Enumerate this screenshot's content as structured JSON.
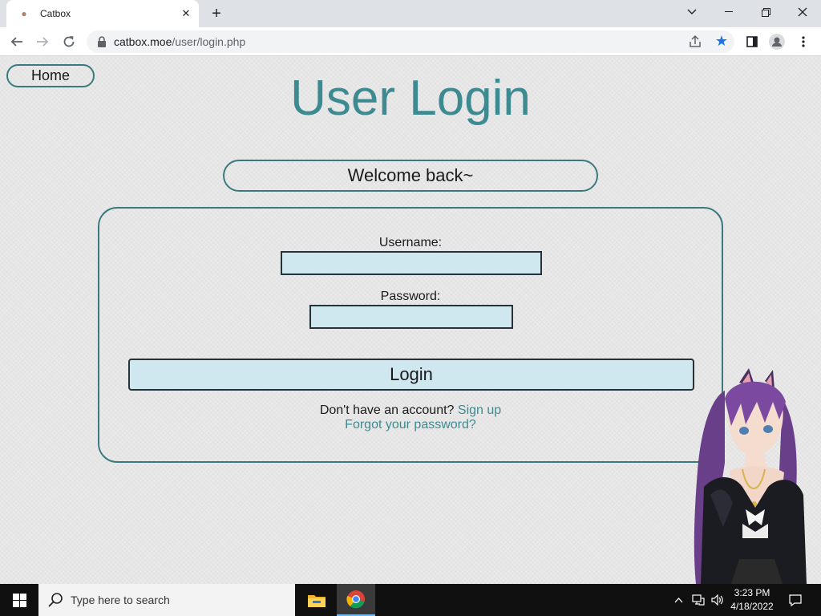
{
  "browser": {
    "tab_title": "Catbox",
    "new_tab_symbol": "+",
    "url_host": "catbox.moe",
    "url_path": "/user/login.php"
  },
  "page": {
    "home_label": "Home",
    "title": "User Login",
    "welcome": "Welcome back~",
    "username_label": "Username:",
    "username_value": "",
    "password_label": "Password:",
    "password_value": "",
    "login_label": "Login",
    "no_account_text": "Don't have an account?",
    "signup_link": "Sign up",
    "forgot_link": "Forgot your password?"
  },
  "taskbar": {
    "search_placeholder": "Type here to search",
    "time": "3:23 PM",
    "date": "4/18/2022"
  },
  "icons": [
    "favicon-icon",
    "close-tab-icon",
    "new-tab-icon",
    "chevron-down-icon",
    "minimize-icon",
    "restore-icon",
    "close-window-icon",
    "back-icon",
    "forward-icon",
    "reload-icon",
    "lock-icon",
    "share-icon",
    "star-icon",
    "side-panel-icon",
    "profile-icon",
    "menu-icon",
    "windows-start-icon",
    "search-icon",
    "file-explorer-icon",
    "chrome-icon",
    "tray-chevron-icon",
    "network-icon",
    "volume-icon",
    "notification-icon"
  ],
  "colors": {
    "accent": "#3d8a91",
    "border": "#3a7a7e",
    "input_fill": "#cfe7ee",
    "bookmark_star": "#1a73e8"
  }
}
